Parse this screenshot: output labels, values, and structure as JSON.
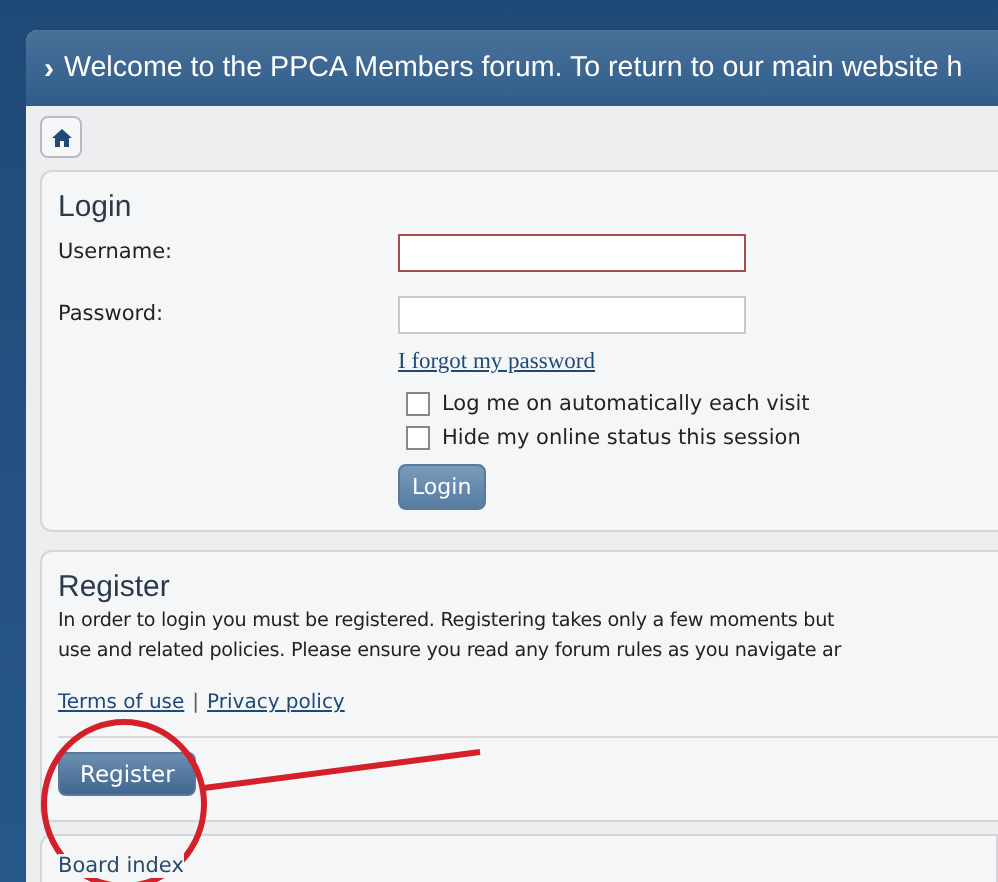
{
  "header": {
    "arrow": "›",
    "text": "Welcome to the PPCA Members forum. To return to our main website h"
  },
  "login": {
    "title": "Login",
    "fields": [
      {
        "label": "Username:",
        "focused": true
      },
      {
        "label": "Password:",
        "focused": false
      }
    ],
    "forgot_link": "I forgot my password",
    "options": [
      {
        "label": "Log me on automatically each visit",
        "checked": false
      },
      {
        "label": "Hide my online status this session",
        "checked": false
      }
    ],
    "button": "Login"
  },
  "register": {
    "title": "Register",
    "lines": [
      "In order to login you must be registered. Registering takes only a few moments but",
      "use and related policies. Please ensure you read any forum rules as you navigate ar"
    ],
    "links": [
      "Terms of use",
      "Privacy policy"
    ],
    "separator": "|",
    "button": "Register"
  },
  "footer": {
    "breadcrumb": "Board index"
  }
}
